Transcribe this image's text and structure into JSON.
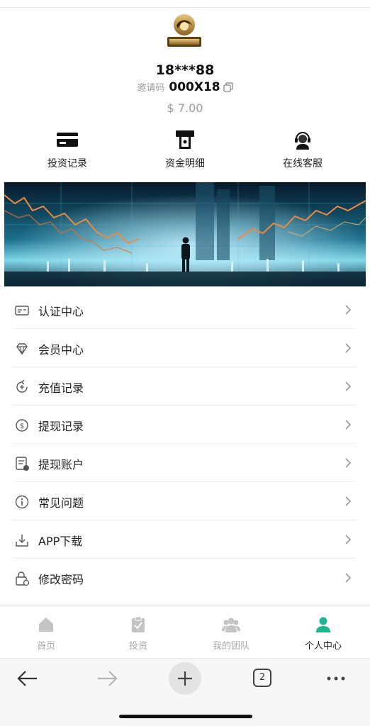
{
  "profile": {
    "username": "18***88",
    "invite_label": "邀请码",
    "invite_code": "000X18",
    "balance": "$ 7.00"
  },
  "quick_actions": [
    {
      "label": "投资记录",
      "icon": "card-icon"
    },
    {
      "label": "资金明细",
      "icon": "atm-icon"
    },
    {
      "label": "在线客服",
      "icon": "headset-agent-icon"
    }
  ],
  "menu": [
    {
      "label": "认证中心",
      "icon": "id-card-icon"
    },
    {
      "label": "会员中心",
      "icon": "diamond-icon"
    },
    {
      "label": "充值记录",
      "icon": "recharge-icon"
    },
    {
      "label": "提现记录",
      "icon": "withdraw-icon"
    },
    {
      "label": "提现账户",
      "icon": "account-icon"
    },
    {
      "label": "常见问题",
      "icon": "info-icon"
    },
    {
      "label": "APP下载",
      "icon": "download-icon"
    },
    {
      "label": "修改密码",
      "icon": "lock-icon"
    }
  ],
  "tabbar": [
    {
      "label": "首页",
      "icon": "home-icon",
      "active": false
    },
    {
      "label": "投资",
      "icon": "clipboard-check-icon",
      "active": false
    },
    {
      "label": "我的团队",
      "icon": "team-icon",
      "active": false
    },
    {
      "label": "个人中心",
      "icon": "user-icon",
      "active": true
    }
  ],
  "browser": {
    "tab_count": "2"
  },
  "colors": {
    "accent": "#1fb58f",
    "inactive": "#aaaaaa",
    "banner_dark": "#08263a",
    "banner_light": "#7fd6e8"
  }
}
